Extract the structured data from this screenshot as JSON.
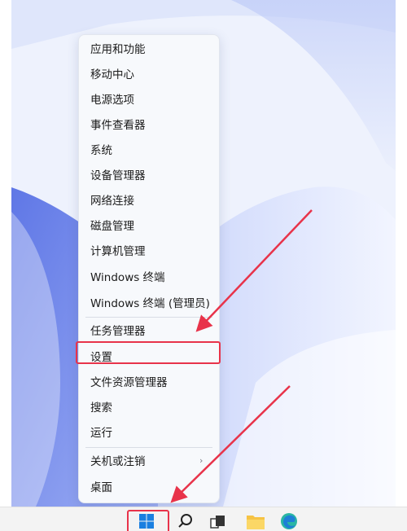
{
  "context_menu": {
    "items": [
      {
        "label": "应用和功能"
      },
      {
        "label": "移动中心"
      },
      {
        "label": "电源选项"
      },
      {
        "label": "事件查看器"
      },
      {
        "label": "系统"
      },
      {
        "label": "设备管理器"
      },
      {
        "label": "网络连接"
      },
      {
        "label": "磁盘管理"
      },
      {
        "label": "计算机管理"
      },
      {
        "label": "Windows 终端"
      },
      {
        "label": "Windows 终端 (管理员)"
      },
      {
        "label": "任务管理器"
      },
      {
        "label": "设置"
      },
      {
        "label": "文件资源管理器"
      },
      {
        "label": "搜索"
      },
      {
        "label": "运行"
      },
      {
        "label": "关机或注销"
      },
      {
        "label": "桌面"
      }
    ],
    "highlighted_item": "设置"
  },
  "taskbar": {
    "icons": [
      "windows-start-icon",
      "search-icon",
      "task-view-icon",
      "file-explorer-icon",
      "edge-icon"
    ]
  },
  "annotations": {
    "highlight_color": "#e8334a"
  }
}
